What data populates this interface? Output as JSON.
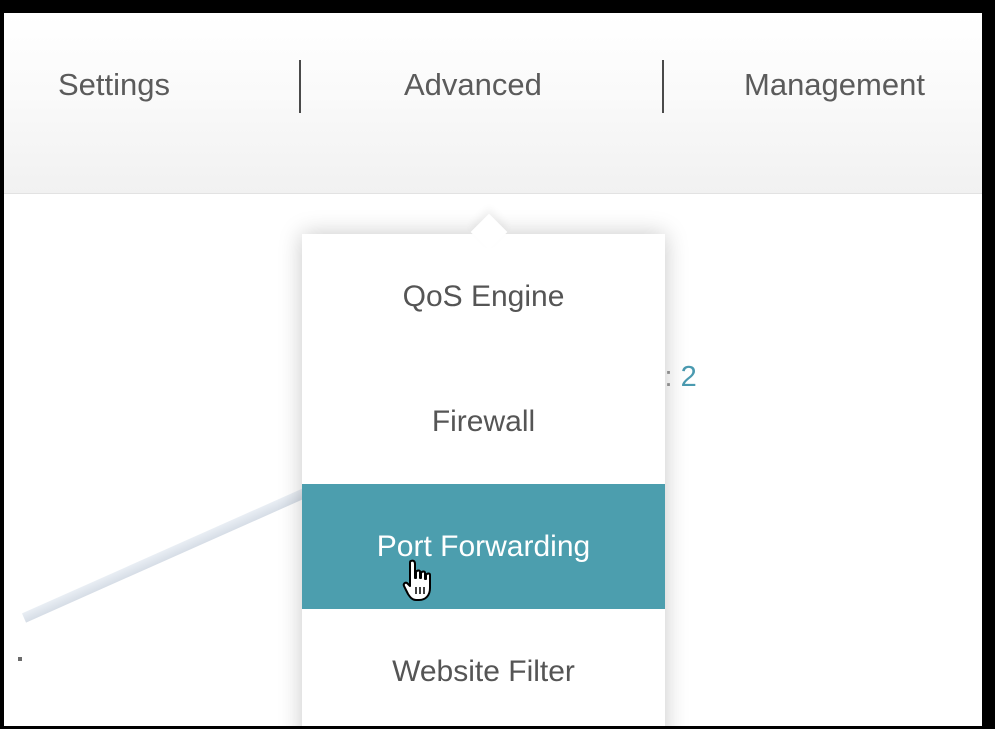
{
  "nav": {
    "items": [
      {
        "label": "Settings"
      },
      {
        "label": "Advanced"
      },
      {
        "label": "Management"
      }
    ]
  },
  "dropdown": {
    "items": [
      {
        "label": "QoS Engine"
      },
      {
        "label": "Firewall"
      },
      {
        "label": "Port Forwarding",
        "state": "hovered"
      },
      {
        "label": "Website Filter"
      }
    ]
  },
  "background": {
    "partial_label": "s:",
    "count": "2"
  },
  "colors": {
    "highlight": "#4c9eae",
    "nav_text": "#5b5b5b",
    "count_text": "#4a9ab0"
  },
  "cursor": {
    "icon": "hand-pointer-icon"
  }
}
